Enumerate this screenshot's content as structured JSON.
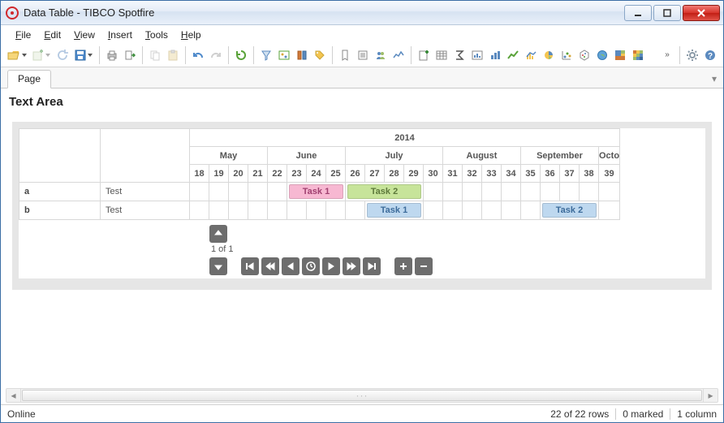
{
  "window": {
    "title": "Data Table - TIBCO Spotfire"
  },
  "menu": {
    "file": "File",
    "edit": "Edit",
    "view": "View",
    "insert": "Insert",
    "tools": "Tools",
    "help": "Help"
  },
  "toolbar_overflow": "»",
  "tabs": {
    "page": "Page"
  },
  "viz": {
    "title": "Text Area"
  },
  "gantt": {
    "year": "2014",
    "months": [
      "May",
      "June",
      "July",
      "August",
      "September",
      "Octo"
    ],
    "weeks": [
      "18",
      "19",
      "20",
      "21",
      "22",
      "23",
      "24",
      "25",
      "26",
      "27",
      "28",
      "29",
      "30",
      "31",
      "32",
      "33",
      "34",
      "35",
      "36",
      "37",
      "38",
      "39"
    ],
    "today_week": "23",
    "rows": [
      {
        "id": "a",
        "label": "Test",
        "tasks": [
          {
            "name": "Task 1",
            "color": "pink",
            "start_wk": "23",
            "span": 3
          },
          {
            "name": "Task 2",
            "color": "green",
            "start_wk": "26",
            "span": 4
          }
        ]
      },
      {
        "id": "b",
        "label": "Test",
        "tasks": [
          {
            "name": "Task 1",
            "color": "blue",
            "start_wk": "27",
            "span": 3
          },
          {
            "name": "Task 2",
            "color": "blue",
            "start_wk": "36",
            "span": 3
          }
        ]
      }
    ],
    "pager": {
      "label": "1 of 1"
    }
  },
  "status": {
    "online": "Online",
    "rows": "22 of 22 rows",
    "marked": "0 marked",
    "columns": "1 column"
  }
}
